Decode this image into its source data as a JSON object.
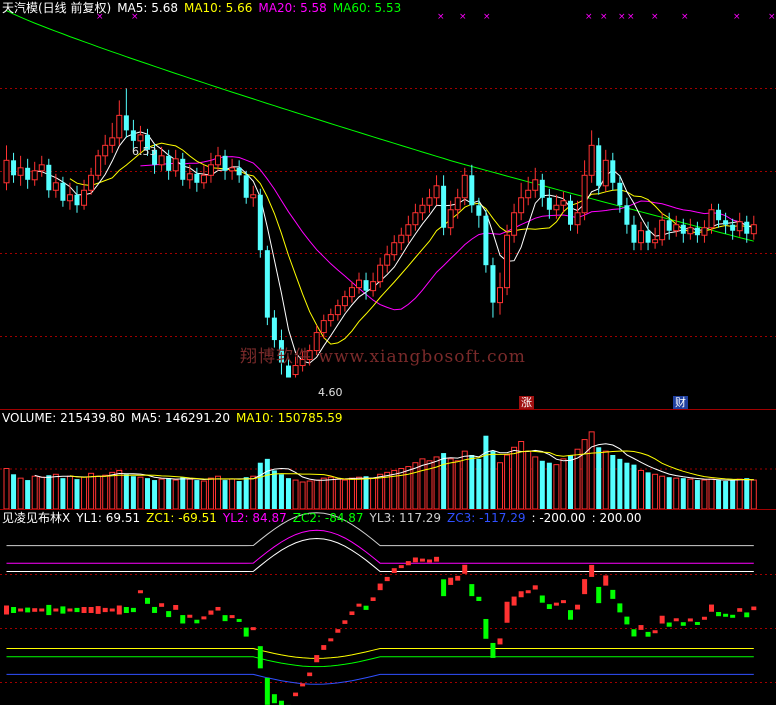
{
  "main_header": {
    "title": "天汽模(日线 前复权)",
    "ma5": "MA5: 5.68",
    "ma10": "MA10: 5.66",
    "ma20": "MA20: 5.58",
    "ma60": "MA60: 5.53"
  },
  "annotations": {
    "high": "6.53",
    "low": "4.60",
    "tag_up": "涨",
    "tag_fin": "财"
  },
  "watermark": "翔博软件 www.xiangbosoft.com",
  "volume_header": {
    "volume": "VOLUME: 215439.80",
    "ma5": "MA5: 146291.20",
    "ma10": "MA10: 150785.59"
  },
  "indicator_header": {
    "name": "见凌见布林X",
    "yl1": "YL1: 69.51",
    "zc1": "ZC1: -69.51",
    "yl2": "YL2: 84.87",
    "zc2": "ZC2: -84.87",
    "yl3": "YL3: 117.29",
    "zc3": "ZC3: -117.29",
    "c1": ": -200.00",
    "c2": ": 200.00"
  },
  "colors": {
    "up": "#ff3232",
    "down": "#54ffff",
    "ma5": "#ffffff",
    "ma10": "#ffff00",
    "ma20": "#ff00ff",
    "ma60": "#00ff00",
    "grid": "#a00000"
  },
  "chart_data": {
    "type": "candlestick",
    "candles": [
      [
        5.9,
        6.05,
        6.15,
        5.85
      ],
      [
        6.05,
        5.95,
        6.1,
        5.9
      ],
      [
        5.95,
        6.0,
        6.08,
        5.88
      ],
      [
        6.0,
        5.92,
        6.06,
        5.86
      ],
      [
        5.92,
        5.98,
        6.04,
        5.88
      ],
      [
        5.98,
        6.02,
        6.08,
        5.94
      ],
      [
        6.02,
        5.85,
        6.06,
        5.8
      ],
      [
        5.85,
        5.9,
        5.96,
        5.8
      ],
      [
        5.9,
        5.78,
        5.94,
        5.74
      ],
      [
        5.78,
        5.82,
        5.9,
        5.72
      ],
      [
        5.82,
        5.75,
        5.88,
        5.7
      ],
      [
        5.75,
        5.85,
        5.92,
        5.72
      ],
      [
        5.85,
        5.95,
        6.0,
        5.82
      ],
      [
        5.95,
        6.08,
        6.12,
        5.92
      ],
      [
        6.08,
        6.15,
        6.22,
        6.02
      ],
      [
        6.15,
        6.2,
        6.3,
        6.1
      ],
      [
        6.2,
        6.35,
        6.45,
        6.15
      ],
      [
        6.35,
        6.25,
        6.53,
        6.2
      ],
      [
        6.25,
        6.18,
        6.32,
        6.12
      ],
      [
        6.18,
        6.22,
        6.28,
        6.1
      ],
      [
        6.22,
        6.12,
        6.26,
        6.08
      ],
      [
        6.12,
        6.02,
        6.16,
        5.96
      ],
      [
        6.02,
        6.08,
        6.14,
        5.98
      ],
      [
        6.08,
        5.98,
        6.12,
        5.92
      ],
      [
        5.98,
        6.06,
        6.12,
        5.94
      ],
      [
        6.06,
        5.92,
        6.1,
        5.88
      ],
      [
        5.92,
        5.96,
        6.02,
        5.86
      ],
      [
        5.96,
        5.9,
        6.0,
        5.84
      ],
      [
        5.9,
        5.95,
        6.02,
        5.86
      ],
      [
        5.95,
        6.02,
        6.1,
        5.9
      ],
      [
        6.02,
        6.08,
        6.14,
        5.98
      ],
      [
        6.08,
        5.98,
        6.12,
        5.92
      ],
      [
        5.98,
        6.0,
        6.06,
        5.92
      ],
      [
        6.0,
        5.95,
        6.05,
        5.9
      ],
      [
        5.95,
        5.8,
        5.98,
        5.76
      ],
      [
        5.8,
        5.82,
        5.88,
        5.74
      ],
      [
        5.82,
        5.45,
        5.86,
        5.4
      ],
      [
        5.45,
        5.0,
        5.48,
        4.95
      ],
      [
        5.0,
        4.85,
        5.05,
        4.8
      ],
      [
        4.85,
        4.7,
        4.92,
        4.62
      ],
      [
        4.68,
        4.6,
        4.72,
        4.6
      ],
      [
        4.62,
        4.68,
        4.74,
        4.6
      ],
      [
        4.68,
        4.72,
        4.78,
        4.64
      ],
      [
        4.72,
        4.78,
        4.82,
        4.68
      ],
      [
        4.78,
        4.9,
        4.95,
        4.75
      ],
      [
        4.9,
        4.98,
        5.02,
        4.86
      ],
      [
        4.98,
        5.02,
        5.06,
        4.94
      ],
      [
        5.02,
        5.08,
        5.12,
        4.98
      ],
      [
        5.08,
        5.14,
        5.18,
        5.04
      ],
      [
        5.14,
        5.2,
        5.24,
        5.1
      ],
      [
        5.2,
        5.25,
        5.3,
        5.16
      ],
      [
        5.25,
        5.18,
        5.3,
        5.12
      ],
      [
        5.18,
        5.24,
        5.3,
        5.14
      ],
      [
        5.24,
        5.35,
        5.4,
        5.2
      ],
      [
        5.35,
        5.42,
        5.48,
        5.3
      ],
      [
        5.42,
        5.5,
        5.55,
        5.38
      ],
      [
        5.5,
        5.55,
        5.6,
        5.45
      ],
      [
        5.55,
        5.62,
        5.68,
        5.5
      ],
      [
        5.62,
        5.7,
        5.76,
        5.58
      ],
      [
        5.7,
        5.75,
        5.8,
        5.65
      ],
      [
        5.75,
        5.8,
        5.86,
        5.7
      ],
      [
        5.8,
        5.88,
        5.95,
        5.75
      ],
      [
        5.88,
        5.6,
        5.95,
        5.55
      ],
      [
        5.6,
        5.72,
        5.78,
        5.55
      ],
      [
        5.72,
        5.8,
        5.86,
        5.66
      ],
      [
        5.8,
        5.95,
        6.0,
        5.75
      ],
      [
        5.95,
        5.75,
        6.02,
        5.7
      ],
      [
        5.75,
        5.68,
        5.8,
        5.6
      ],
      [
        5.68,
        5.35,
        5.72,
        5.3
      ],
      [
        5.35,
        5.1,
        5.4,
        5.0
      ],
      [
        5.1,
        5.2,
        5.3,
        5.02
      ],
      [
        5.2,
        5.55,
        5.62,
        5.15
      ],
      [
        5.55,
        5.7,
        5.76,
        5.5
      ],
      [
        5.7,
        5.8,
        5.9,
        5.65
      ],
      [
        5.8,
        5.85,
        5.94,
        5.75
      ],
      [
        5.85,
        5.92,
        6.0,
        5.8
      ],
      [
        5.92,
        5.8,
        5.96,
        5.74
      ],
      [
        5.8,
        5.72,
        5.86,
        5.66
      ],
      [
        5.72,
        5.75,
        5.82,
        5.66
      ],
      [
        5.75,
        5.78,
        5.84,
        5.7
      ],
      [
        5.78,
        5.62,
        5.82,
        5.58
      ],
      [
        5.62,
        5.7,
        5.78,
        5.56
      ],
      [
        5.7,
        5.95,
        6.05,
        5.65
      ],
      [
        5.95,
        6.15,
        6.25,
        5.9
      ],
      [
        6.15,
        5.88,
        6.2,
        5.82
      ],
      [
        5.88,
        6.05,
        6.12,
        5.84
      ],
      [
        6.05,
        5.9,
        6.1,
        5.85
      ],
      [
        5.9,
        5.75,
        5.95,
        5.7
      ],
      [
        5.75,
        5.62,
        5.8,
        5.56
      ],
      [
        5.62,
        5.5,
        5.68,
        5.45
      ],
      [
        5.5,
        5.58,
        5.64,
        5.45
      ],
      [
        5.58,
        5.5,
        5.64,
        5.45
      ],
      [
        5.5,
        5.52,
        5.6,
        5.46
      ],
      [
        5.52,
        5.65,
        5.7,
        5.48
      ],
      [
        5.65,
        5.58,
        5.7,
        5.52
      ],
      [
        5.58,
        5.62,
        5.68,
        5.54
      ],
      [
        5.62,
        5.56,
        5.66,
        5.5
      ],
      [
        5.56,
        5.6,
        5.66,
        5.52
      ],
      [
        5.6,
        5.55,
        5.64,
        5.5
      ],
      [
        5.55,
        5.6,
        5.65,
        5.5
      ],
      [
        5.6,
        5.72,
        5.76,
        5.56
      ],
      [
        5.72,
        5.65,
        5.76,
        5.6
      ],
      [
        5.65,
        5.62,
        5.7,
        5.56
      ],
      [
        5.62,
        5.58,
        5.66,
        5.52
      ],
      [
        5.58,
        5.64,
        5.7,
        5.54
      ],
      [
        5.64,
        5.56,
        5.68,
        5.5
      ],
      [
        5.56,
        5.62,
        5.68,
        5.52
      ]
    ],
    "volumes": [
      210,
      180,
      160,
      150,
      170,
      165,
      175,
      180,
      160,
      170,
      155,
      165,
      185,
      170,
      175,
      190,
      200,
      180,
      170,
      165,
      160,
      150,
      155,
      160,
      150,
      165,
      155,
      150,
      145,
      160,
      170,
      150,
      155,
      145,
      165,
      170,
      240,
      260,
      200,
      180,
      160,
      150,
      140,
      145,
      150,
      160,
      165,
      155,
      150,
      160,
      165,
      170,
      160,
      180,
      190,
      200,
      210,
      220,
      240,
      260,
      250,
      270,
      290,
      260,
      250,
      300,
      280,
      260,
      380,
      300,
      240,
      280,
      320,
      350,
      300,
      270,
      250,
      240,
      230,
      260,
      280,
      310,
      360,
      400,
      320,
      300,
      280,
      260,
      240,
      230,
      200,
      190,
      180,
      170,
      165,
      160,
      160,
      155,
      150,
      150,
      155,
      150,
      145,
      150,
      155,
      160,
      150
    ]
  }
}
